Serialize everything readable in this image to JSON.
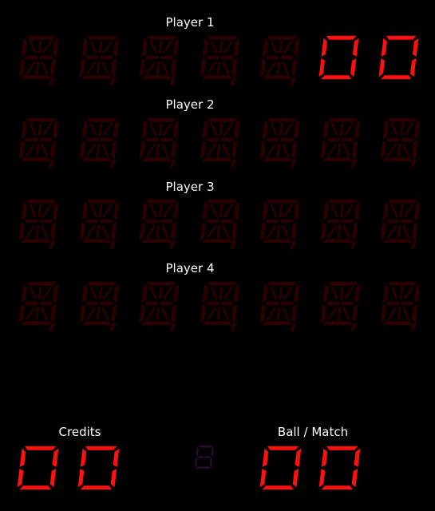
{
  "colors": {
    "lit": "#ff1010",
    "unlit": "#2a0000",
    "unlit_small": "#2a0a30",
    "label": "#ffffff",
    "background": "#000000"
  },
  "players": [
    {
      "label": "Player 1",
      "digits": [
        " ",
        " ",
        " ",
        " ",
        " ",
        "0",
        "0"
      ]
    },
    {
      "label": "Player 2",
      "digits": [
        " ",
        " ",
        " ",
        " ",
        " ",
        " ",
        " "
      ]
    },
    {
      "label": "Player 3",
      "digits": [
        " ",
        " ",
        " ",
        " ",
        " ",
        " ",
        " "
      ]
    },
    {
      "label": "Player 4",
      "digits": [
        " ",
        " ",
        " ",
        " ",
        " ",
        " ",
        " "
      ]
    }
  ],
  "credits": {
    "label": "Credits",
    "digits": [
      "0",
      "0"
    ]
  },
  "ball_match": {
    "label": "Ball / Match",
    "digits": [
      "0",
      "0"
    ]
  },
  "center_indicator": {
    "digit": " "
  }
}
